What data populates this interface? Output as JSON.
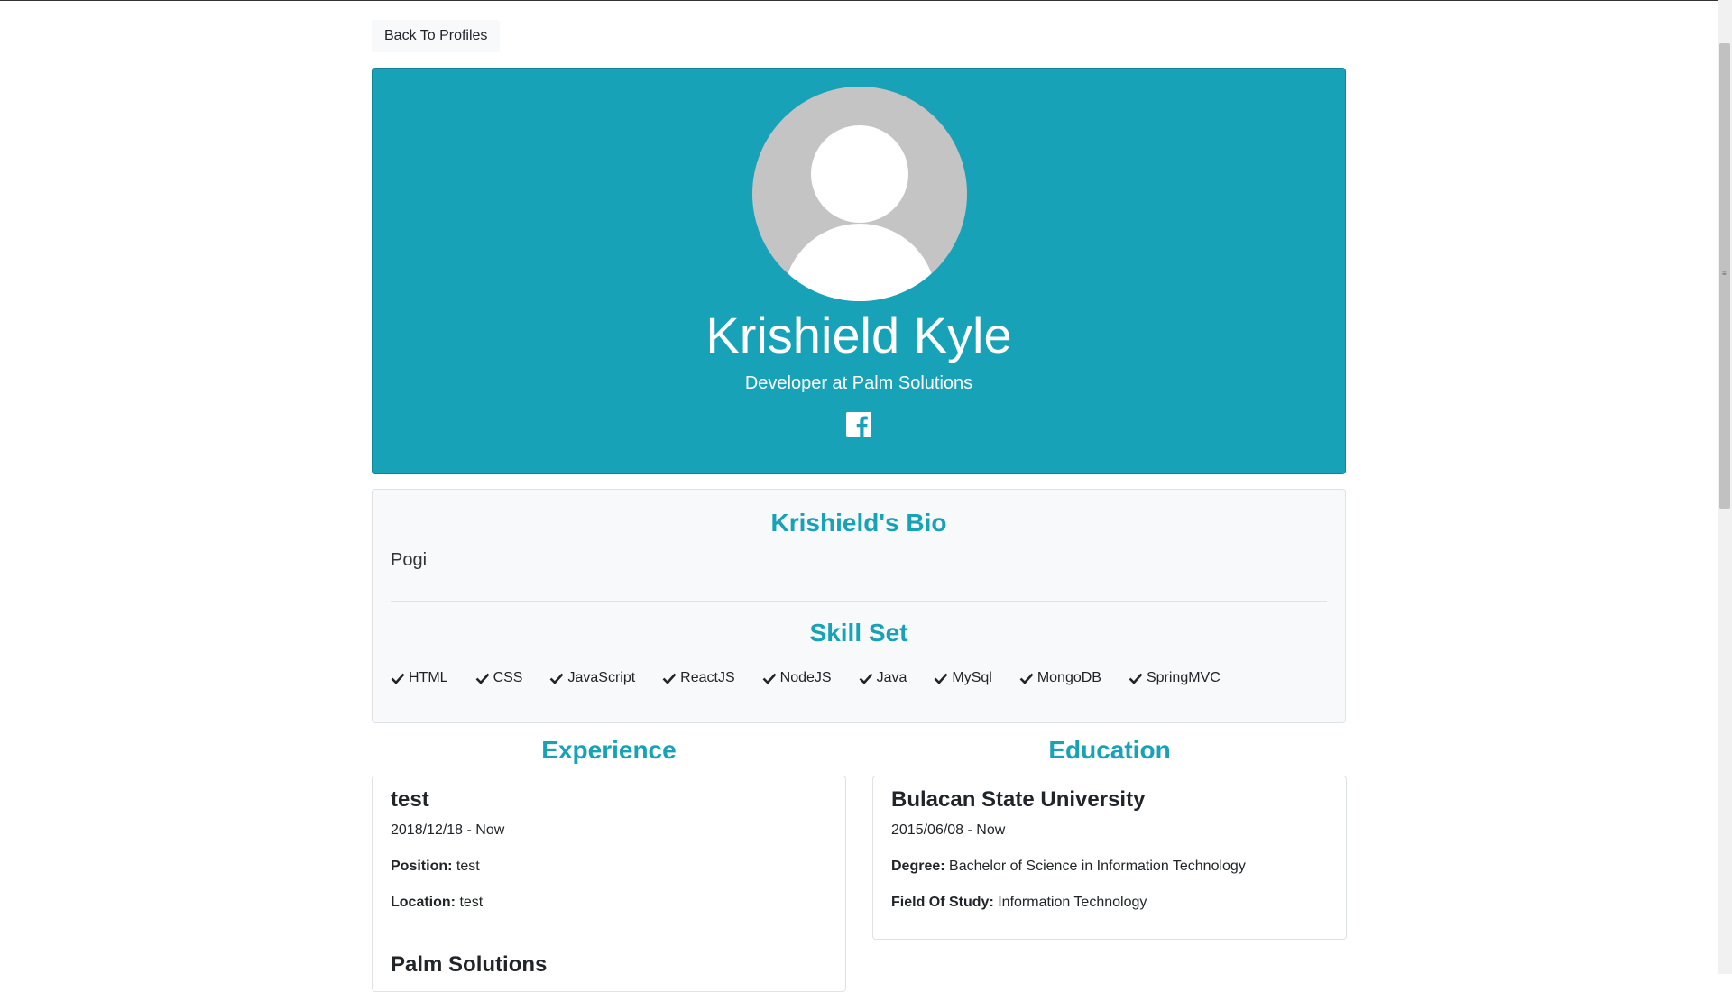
{
  "nav": {
    "back_label": "Back To Profiles"
  },
  "profile": {
    "name": "Krishield Kyle",
    "subtitle": "Developer at Palm Solutions",
    "avatar_icon": "default-avatar-icon",
    "social_icon": "facebook-icon",
    "hero_color": "#17a2b8"
  },
  "bio": {
    "title": "Krishield's Bio",
    "text": "Pogi"
  },
  "skills": {
    "title": "Skill Set",
    "items": [
      "HTML",
      "CSS",
      "JavaScript",
      "ReactJS",
      "NodeJS",
      "Java",
      "MySql",
      "MongoDB",
      "SpringMVC"
    ]
  },
  "experience": {
    "title": "Experience",
    "items": [
      {
        "company": "test",
        "dates": "2018/12/18 - Now",
        "position_label": "Position:",
        "position": "test",
        "location_label": "Location:",
        "location": "test"
      },
      {
        "company": "Palm Solutions"
      }
    ]
  },
  "education": {
    "title": "Education",
    "items": [
      {
        "school": "Bulacan State University",
        "dates": "2015/06/08 - Now",
        "degree_label": "Degree:",
        "degree": "Bachelor of Science in Information Technology",
        "field_label": "Field Of Study:",
        "field": "Information Technology"
      }
    ]
  }
}
